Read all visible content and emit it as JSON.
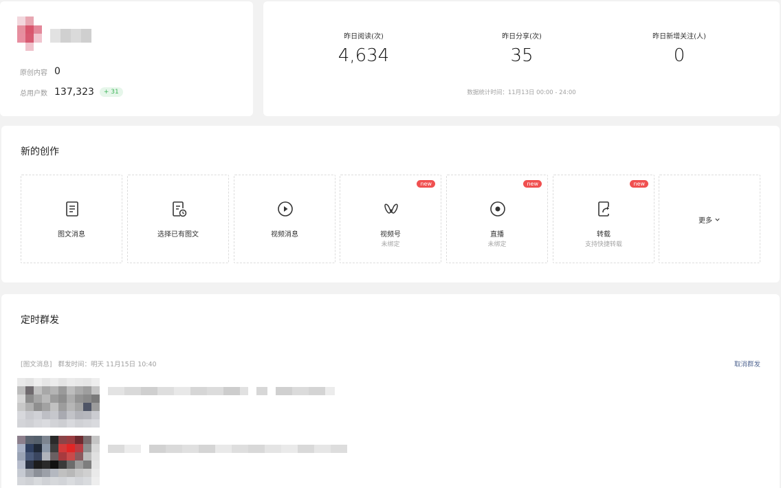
{
  "profile": {
    "original_label": "原创内容",
    "original_value": "0",
    "users_label": "总用户数",
    "users_value": "137,323",
    "users_growth": "+ 31"
  },
  "stats": {
    "items": [
      {
        "label": "昨日阅读(次)",
        "value": "4,634"
      },
      {
        "label": "昨日分享(次)",
        "value": "35"
      },
      {
        "label": "昨日新增关注(人)",
        "value": "0"
      }
    ],
    "note": "数据统计时间：11月13日 00:00 - 24:00"
  },
  "create": {
    "title": "新的创作",
    "tiles": [
      {
        "label": "图文消息",
        "sub": "",
        "badge": "",
        "icon": "document-icon"
      },
      {
        "label": "选择已有图文",
        "sub": "",
        "badge": "",
        "icon": "document-clock-icon"
      },
      {
        "label": "视频消息",
        "sub": "",
        "badge": "",
        "icon": "play-circle-icon"
      },
      {
        "label": "视频号",
        "sub": "未绑定",
        "badge": "new",
        "icon": "channels-icon"
      },
      {
        "label": "直播",
        "sub": "未绑定",
        "badge": "new",
        "icon": "live-icon"
      },
      {
        "label": "转载",
        "sub": "支持快捷转载",
        "badge": "new",
        "icon": "repost-icon"
      }
    ],
    "more_label": "更多",
    "more_icon": "chevron-down-icon"
  },
  "schedule": {
    "title": "定时群发",
    "type_label": "[图文消息]",
    "time_label": "群发时间：明天 11月15日 10:40",
    "cancel_label": "取消群发"
  },
  "colors": {
    "badge_red": "#f05050",
    "growth_green": "#3fb55a",
    "link_blue": "#576b95"
  }
}
